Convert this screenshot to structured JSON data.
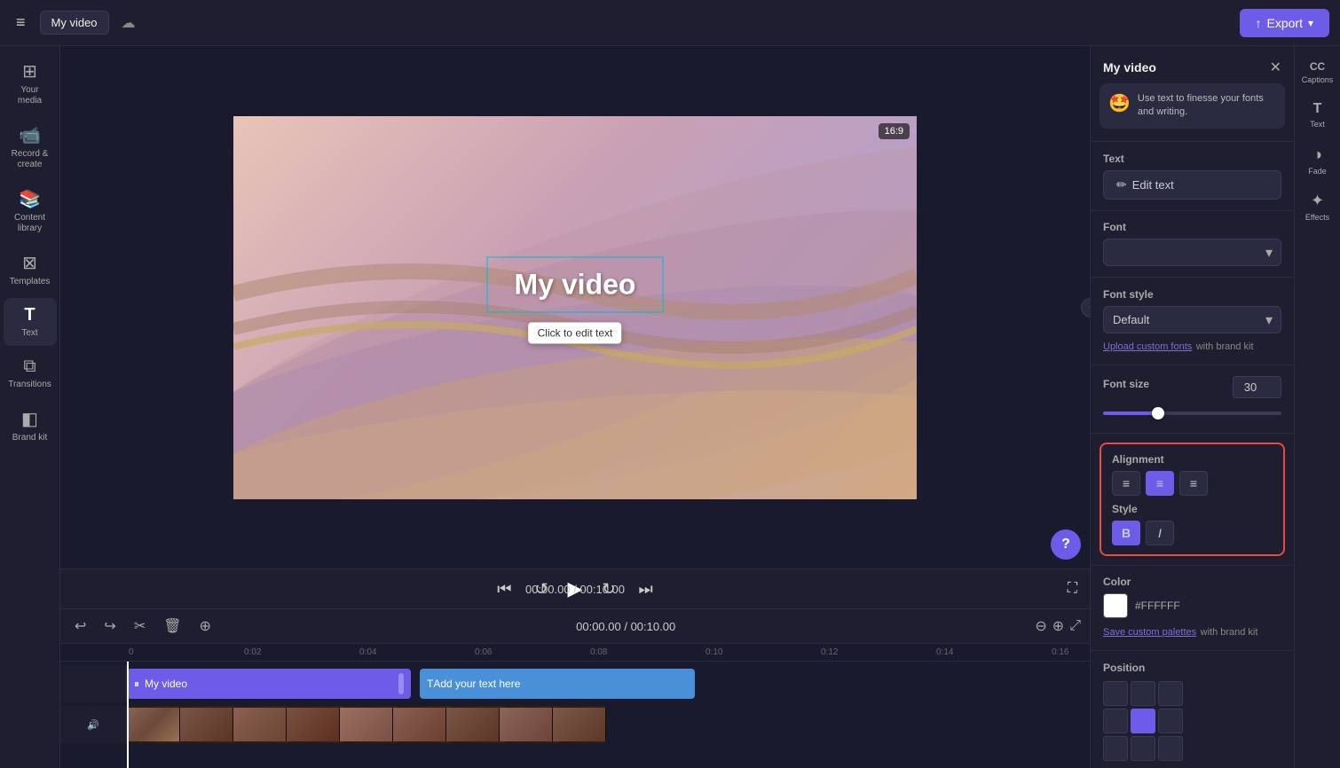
{
  "topbar": {
    "menu_label": "≡",
    "title": "My video",
    "cloud_icon": "☁",
    "export_label": "Export",
    "export_icon": "↑"
  },
  "sidebar": {
    "items": [
      {
        "id": "your-media",
        "icon": "⊞",
        "label": "Your media"
      },
      {
        "id": "record-create",
        "icon": "🎥",
        "label": "Record & create"
      },
      {
        "id": "content-library",
        "icon": "⊟",
        "label": "Content library"
      },
      {
        "id": "templates",
        "icon": "⊠",
        "label": "Templates"
      },
      {
        "id": "text",
        "icon": "T",
        "label": "Text"
      },
      {
        "id": "transitions",
        "icon": "⧉",
        "label": "Transitions"
      },
      {
        "id": "brand-kit",
        "icon": "◧",
        "label": "Brand kit"
      }
    ]
  },
  "canvas": {
    "ratio_badge": "16:9",
    "title_text": "My video",
    "tooltip_text": "Click to edit text"
  },
  "playback": {
    "current_time": "00:00.00",
    "total_time": "00:10.00",
    "time_display": "00:00.00 / 00:10.00"
  },
  "timeline": {
    "ruler_marks": [
      "0",
      "|0:02",
      "|0:04",
      "|0:06",
      "|0:08",
      "|0:10",
      "|0:12",
      "|0:14",
      "|0:16"
    ],
    "video_clip_label": "My video",
    "text_clip_label": "Add your text here"
  },
  "right_panel": {
    "title": "My video",
    "close_icon": "✕",
    "tip_emoji": "🤩",
    "tip_text": "Use text to finesse your fonts and writing.",
    "text_section_label": "Text",
    "edit_text_label": "Edit text",
    "font_section_label": "Font",
    "font_style_section_label": "Font style",
    "font_style_value": "Default",
    "upload_fonts_link": "Upload custom fonts",
    "upload_fonts_suffix": " with brand kit",
    "font_size_label": "Font size",
    "font_size_value": "30",
    "alignment_label": "Alignment",
    "style_label": "Style",
    "color_label": "Color",
    "color_hex": "#FFFFFF",
    "save_palettes_link": "Save custom palettes",
    "save_palettes_suffix": " with brand kit",
    "position_label": "Position"
  },
  "far_right": {
    "items": [
      {
        "id": "captions",
        "icon": "CC",
        "label": "Captions"
      },
      {
        "id": "text",
        "icon": "T",
        "label": "Text"
      },
      {
        "id": "fade",
        "icon": "◑",
        "label": "Fade"
      },
      {
        "id": "effects",
        "icon": "✦",
        "label": "Effects"
      }
    ]
  }
}
